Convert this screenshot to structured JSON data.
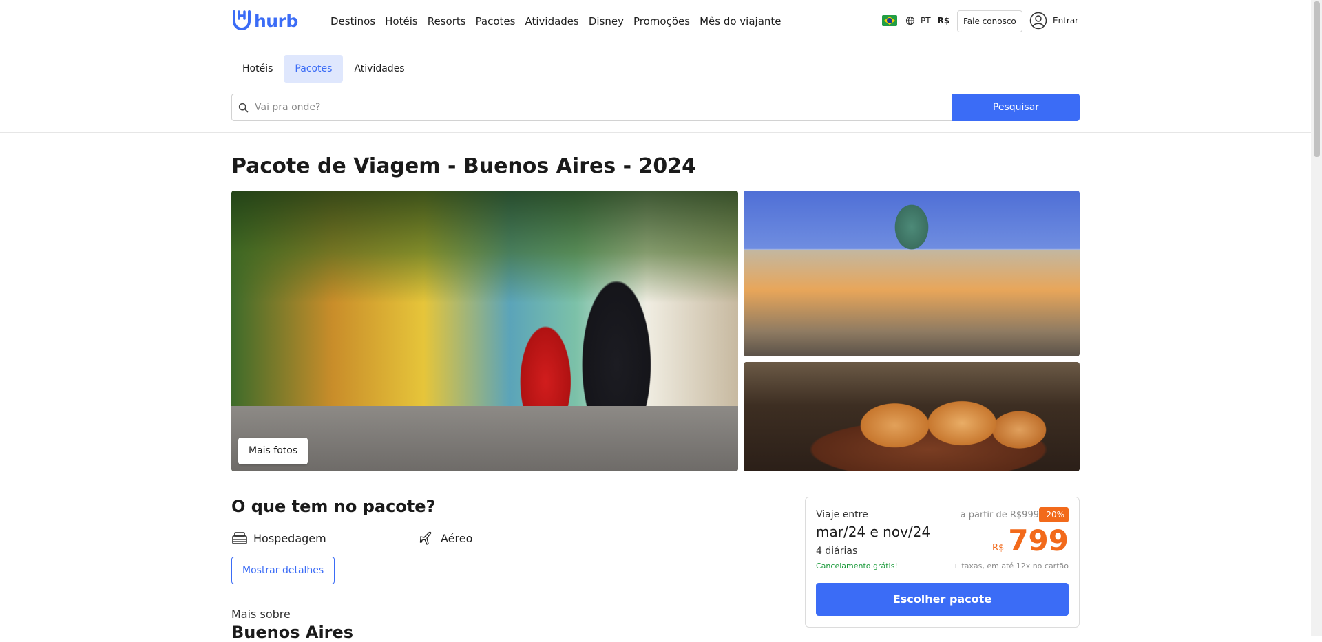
{
  "header": {
    "logo_text": "hurb",
    "nav": [
      "Destinos",
      "Hotéis",
      "Resorts",
      "Pacotes",
      "Atividades",
      "Disney",
      "Promoções",
      "Mês do viajante"
    ],
    "language": "PT",
    "currency": "R$",
    "contact_label": "Fale conosco",
    "login_label": "Entrar"
  },
  "product_tabs": [
    "Hotéis",
    "Pacotes",
    "Atividades"
  ],
  "active_tab": "Pacotes",
  "search": {
    "placeholder": "Vai pra onde?",
    "button_label": "Pesquisar"
  },
  "page_title": "Pacote de Viagem - Buenos Aires - 2024",
  "gallery": {
    "more_photos_label": "Mais fotos"
  },
  "package": {
    "heading": "O que tem no pacote?",
    "items": [
      {
        "label": "Hospedagem",
        "icon": "bed-icon"
      },
      {
        "label": "Aéreo",
        "icon": "plane-icon"
      }
    ],
    "details_label": "Mostrar detalhes",
    "more_about_label": "Mais sobre",
    "city": "Buenos Aires"
  },
  "offer": {
    "travel_between_label": "Viaje entre",
    "dates": "mar/24 e nov/24",
    "nights": "4 diárias",
    "cancellation": "Cancelamento grátis!",
    "from_label": "a partir de",
    "old_price": "R$999",
    "discount": "-20%",
    "currency": "R$",
    "price": "799",
    "tax_note": "+ taxas, em até 12x no cartão",
    "choose_label": "Escolher pacote"
  },
  "colors": {
    "brand_blue": "#3b6cf6",
    "discount_orange": "#f26a1b",
    "free_cancel_green": "#1a9a3a"
  }
}
